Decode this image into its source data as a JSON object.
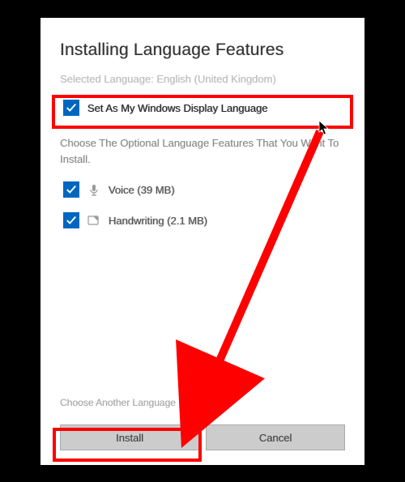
{
  "dialog": {
    "title": "Installing Language Features",
    "selected_label": "Selected Language: English (United Kingdom)",
    "display_lang": {
      "label": "Set As My Windows Display Language",
      "checked": true
    },
    "instruction": "Choose The Optional Language Features That You Want To Install.",
    "features": [
      {
        "name": "voice",
        "label": "Voice (39 MB)",
        "checked": true
      },
      {
        "name": "handwriting",
        "label": "Handwriting (2.1 MB)",
        "checked": true
      }
    ],
    "link": "Choose Another Language",
    "buttons": {
      "install": "Install",
      "cancel": "Cancel"
    }
  }
}
